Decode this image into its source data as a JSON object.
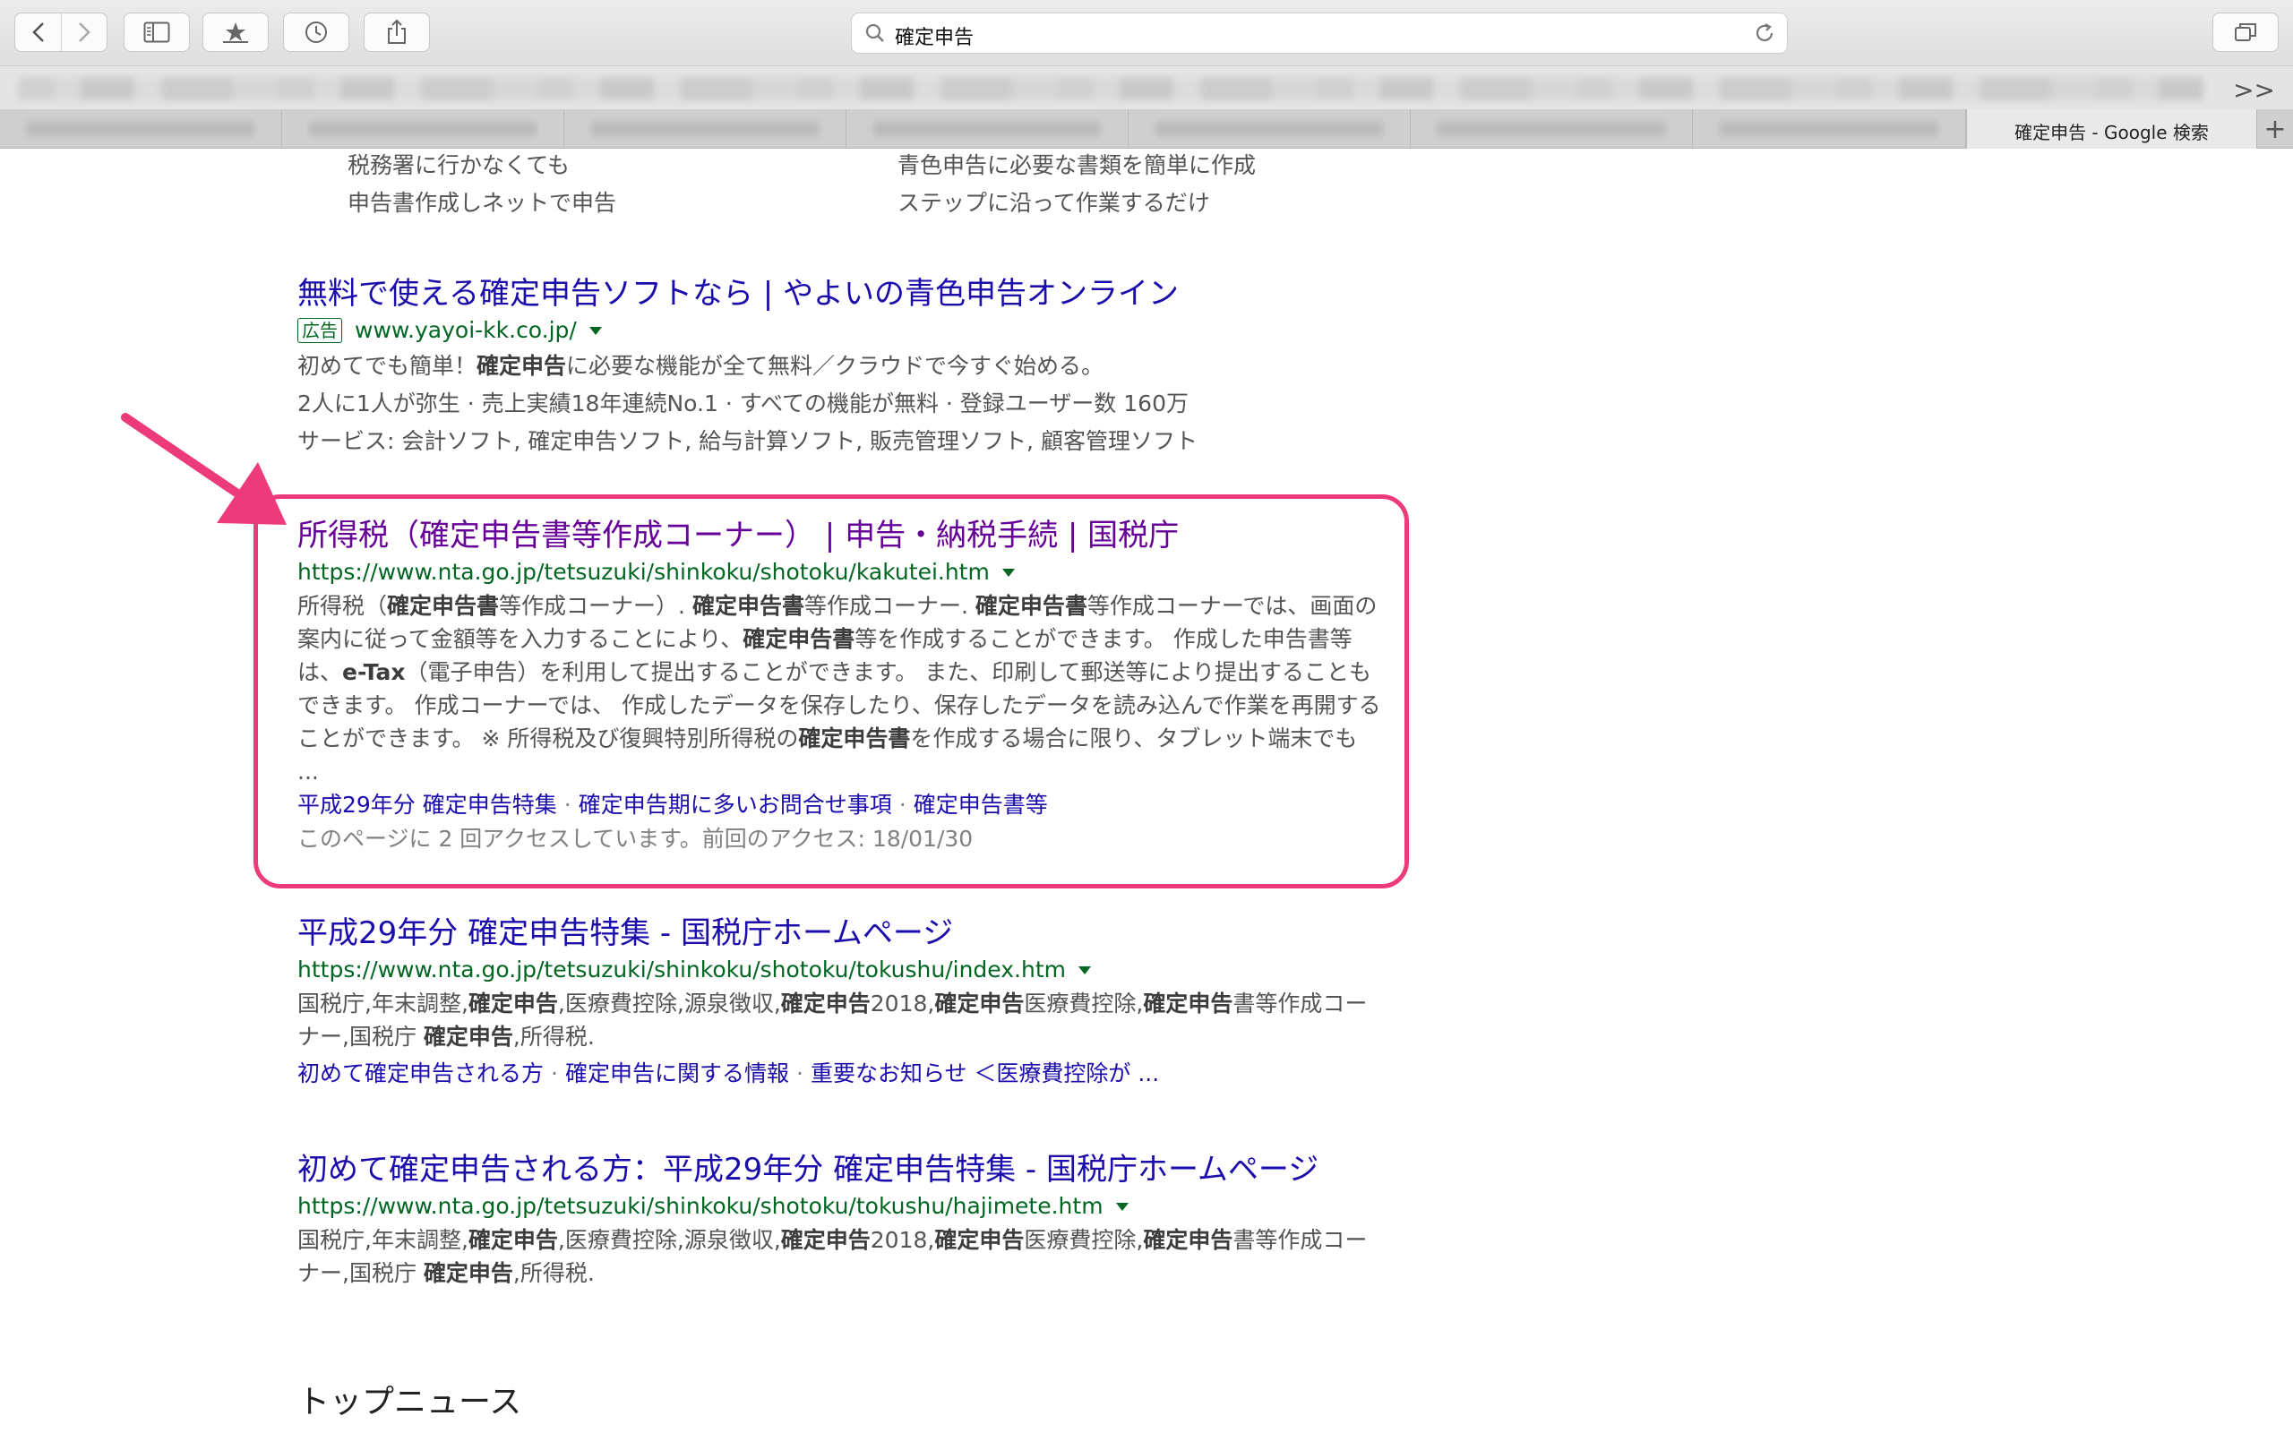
{
  "browser": {
    "address_text": "確定申告",
    "active_tab_label": "確定申告 - Google 検索",
    "overflow_label": ">>",
    "new_tab_label": "+"
  },
  "top_sitelinks": {
    "left": [
      "税務署に行かなくても",
      "申告書作成しネットで申告"
    ],
    "right": [
      "青色申告に必要な書類を簡単に作成",
      "ステップに沿って作業するだけ"
    ]
  },
  "ad_result": {
    "title": "無料で使える確定申告ソフトなら | やよいの青色申告オンライン",
    "badge": "広告",
    "url": "www.yayoi-kk.co.jp/",
    "line1_pre": "初めてでも簡単！",
    "line1_bold": "確定申告",
    "line1_post": "に必要な機能が全て無料／クラウドで今すぐ始める。",
    "line2": "2人に1人が弥生 · 売上実績18年連続No.1 · すべての機能が無料 · 登録ユーザー数 160万",
    "line3": "サービス: 会計ソフト, 確定申告ソフト, 給与計算ソフト, 販売管理ソフト, 顧客管理ソフト"
  },
  "result1": {
    "title": "所得税（確定申告書等作成コーナー） | 申告・納税手続 | 国税庁",
    "url": "https://www.nta.go.jp/tetsuzuki/shinkoku/shotoku/kakutei.htm",
    "links": [
      "平成29年分 確定申告特集",
      "確定申告期に多いお問合せ事項",
      "確定申告書等"
    ],
    "link_sep": "·",
    "visit": "このページに 2 回アクセスしています。前回のアクセス: 18/01/30"
  },
  "result2": {
    "title": "平成29年分 確定申告特集 - 国税庁ホームページ",
    "url": "https://www.nta.go.jp/tetsuzuki/shinkoku/shotoku/tokushu/index.htm",
    "links": [
      "初めて確定申告される方",
      "確定申告に関する情報",
      "重要なお知らせ ＜医療費控除が ..."
    ],
    "link_sep": "·"
  },
  "result3": {
    "title": "初めて確定申告される方：平成29年分 確定申告特集 - 国税庁ホームページ",
    "url": "https://www.nta.go.jp/tetsuzuki/shinkoku/shotoku/tokushu/hajimete.htm"
  },
  "snippet_parts": {
    "s1": "所得税（",
    "b1": "確定申告書",
    "s2": "等作成コーナー）. ",
    "b2": "確定申告書",
    "s3": "等作成コーナー. ",
    "b3": "確定申告書",
    "s4": "等作成コーナーでは、画面の案内に従って金額等を入力することにより、",
    "b4": "確定申告書",
    "s5": "等を作成することができます。 作成した申告書等は、",
    "b5": "e-Tax",
    "s6": "（電子申告）を利用して提出することができます。 また、印刷して郵送等により提出することもできます。 作成コーナーでは、 作成したデータを保存したり、保存したデータを読み込んで作業を再開することができます。 ※ 所得税及び復興特別所得税の",
    "b6": "確定申告書",
    "s7": "を作成する場合に限り、タブレット端末でも ...",
    "k1": "国税庁,年末調整,",
    "kb1": "確定申告",
    "k2": ",医療費控除,源泉徴収,",
    "kb2": "確定申告",
    "k3": "2018,",
    "kb3": "確定申告",
    "k4": "医療費控除,",
    "kb4": "確定申告",
    "k5": "書等作成コーナー,国税庁 ",
    "kb5": "確定申告",
    "k6": ",所得税."
  },
  "section_heading": "トップニュース",
  "colors": {
    "link": "#1a0dab",
    "visited": "#660099",
    "url_green": "#006621",
    "highlight": "#ec3a7a"
  }
}
